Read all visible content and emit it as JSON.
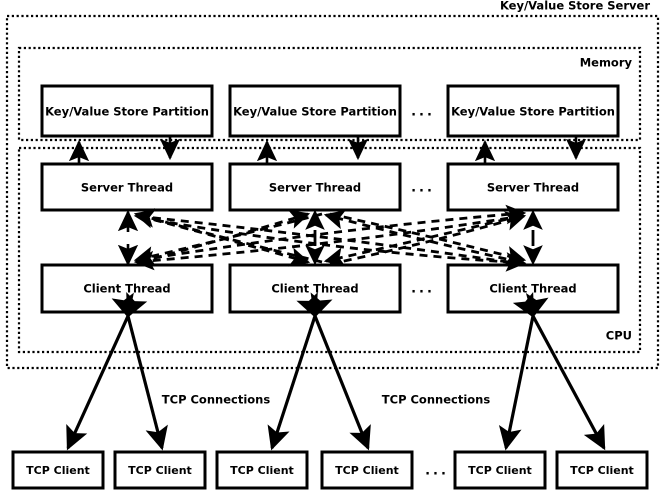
{
  "diagram": {
    "title": "Key/Value Store Server",
    "zones": [
      {
        "id": "server",
        "label": "Key/Value Store Server"
      },
      {
        "id": "memory",
        "label": "Memory"
      },
      {
        "id": "cpu",
        "label": "CPU"
      }
    ],
    "rows": {
      "partitions": {
        "label": "Key/Value Store Partition",
        "items": [
          {
            "label": "Key/Value Store Partition"
          },
          {
            "label": "Key/Value Store Partition"
          },
          {
            "label": "Key/Value Store Partition"
          }
        ],
        "ellipsis": "..."
      },
      "server_threads": {
        "label": "Server Thread",
        "items": [
          {
            "label": "Server Thread"
          },
          {
            "label": "Server Thread"
          },
          {
            "label": "Server Thread"
          }
        ],
        "ellipsis": "..."
      },
      "client_threads": {
        "label": "Client Thread",
        "items": [
          {
            "label": "Client Thread"
          },
          {
            "label": "Client Thread"
          },
          {
            "label": "Client Thread"
          }
        ],
        "ellipsis": "..."
      },
      "tcp_clients": {
        "label": "TCP Client",
        "items": [
          {
            "label": "TCP Client"
          },
          {
            "label": "TCP Client"
          },
          {
            "label": "TCP Client"
          },
          {
            "label": "TCP Client"
          },
          {
            "label": "TCP Client"
          },
          {
            "label": "TCP Client"
          }
        ],
        "ellipsis": "..."
      }
    },
    "connection_labels": [
      {
        "label": "TCP Connections"
      },
      {
        "label": "TCP Connections"
      }
    ],
    "colors": {
      "stroke": "#000000",
      "fill": "#ffffff",
      "background": "#ffffff"
    }
  }
}
